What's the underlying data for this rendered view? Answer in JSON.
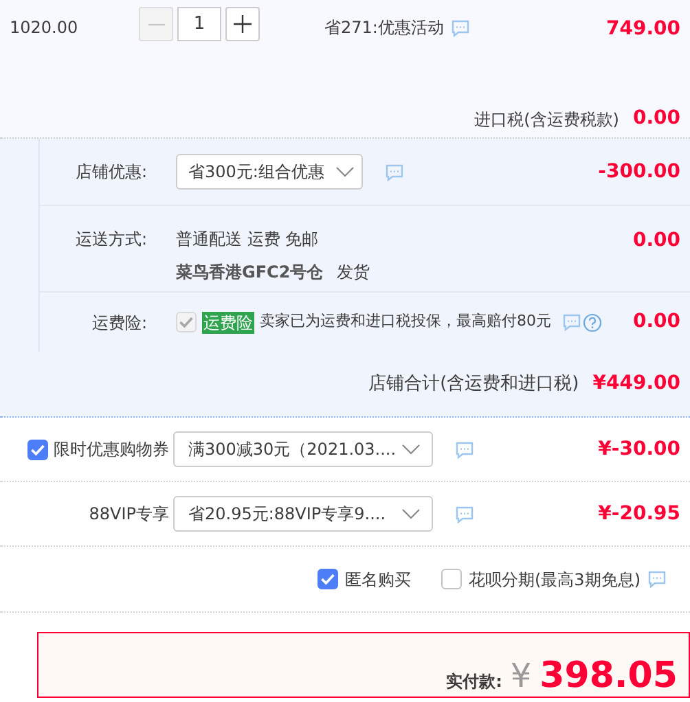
{
  "product": {
    "unit_price": "1020.00",
    "quantity": "1",
    "decrease_disabled": true,
    "promo": "省271:优惠活动",
    "subtotal": "749.00"
  },
  "import_tax": {
    "label": "进口税(含运费税款)",
    "amount": "0.00"
  },
  "store_rows": [
    {
      "kind": "select",
      "label": "店铺优惠:",
      "value": "省300元:组合优惠",
      "amount": "-300.00"
    },
    {
      "kind": "shipping",
      "label": "运送方式:",
      "method": "普通配送 运费 免邮",
      "warehouse": "菜鸟香港GFC2号仓",
      "ship_note": "发货",
      "amount": "0.00"
    },
    {
      "kind": "insurance",
      "label": "运费险:",
      "checked": true,
      "disabled": true,
      "badge": "运费险",
      "text": "卖家已为运费和进口税投保，最高赔付80元",
      "amount": "0.00"
    }
  ],
  "store_total": {
    "label": "店铺合计(含运费和进口税)",
    "amount": "¥449.00"
  },
  "discounts": [
    {
      "kind": "checkbox",
      "checked": true,
      "label": "限时优惠购物券",
      "value": "满300减30元（2021.03....",
      "amount": "¥-30.00"
    },
    {
      "kind": "plain",
      "label": "88VIP专享",
      "value": "省20.95元:88VIP专享9....",
      "amount": "¥-20.95"
    }
  ],
  "options": [
    {
      "label": "匿名购买",
      "checked": true,
      "info": false
    },
    {
      "label": "花呗分期(最高3期免息)",
      "checked": false,
      "info": true
    }
  ],
  "payment": {
    "label": "实付款:",
    "currency": "¥",
    "amount": "398.05"
  }
}
